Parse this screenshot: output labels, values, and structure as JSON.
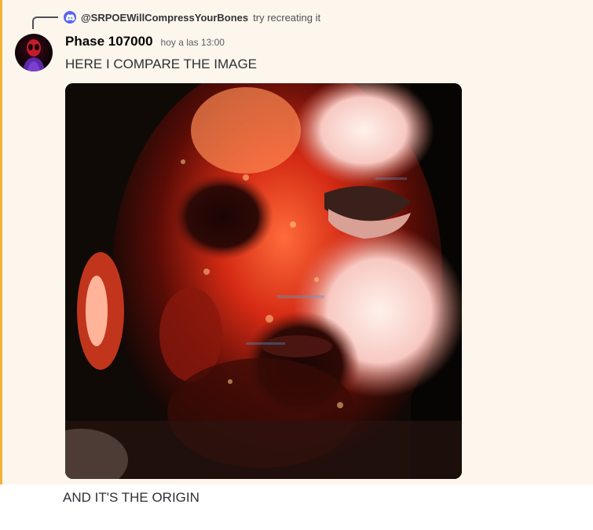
{
  "reply": {
    "author": "@SRPOEWillCompressYourBones",
    "text": "try recreating it",
    "avatar_icon": "discord-logo-icon"
  },
  "message": {
    "username": "Phase 107000",
    "timestamp": "hoy a las 13:00",
    "text": "HERE I COMPARE THE IMAGE",
    "attachment_icon": "distorted-face-photo"
  },
  "next_message": {
    "text": "AND IT'S THE ORIGIN"
  },
  "colors": {
    "highlight_background": "#fdf6ec",
    "mention_bar": "#f0b232",
    "discord_blurple": "#5865f2"
  }
}
